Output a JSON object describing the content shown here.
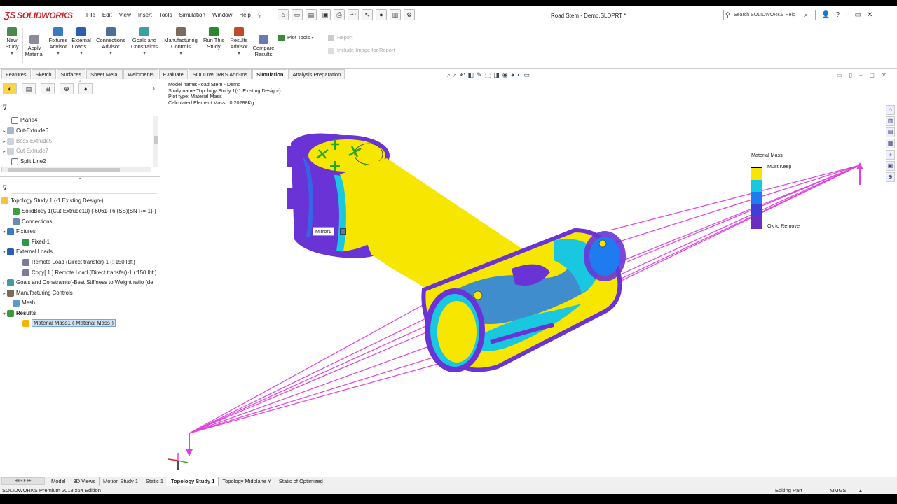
{
  "app": {
    "logo": "SOLIDWORKS",
    "document_title": "Road Stem - Demo.SLDPRT *"
  },
  "menu": [
    "File",
    "Edit",
    "View",
    "Insert",
    "Tools",
    "Simulation",
    "Window",
    "Help"
  ],
  "search": {
    "placeholder": "Search SOLIDWORKS Help"
  },
  "command_manager": {
    "buttons": [
      {
        "line1": "New",
        "line2": "Study"
      },
      {
        "line1": "Apply",
        "line2": "Material"
      },
      {
        "line1": "Fixtures",
        "line2": "Advisor"
      },
      {
        "line1": "External",
        "line2": "Loads..."
      },
      {
        "line1": "Connections",
        "line2": "Advisor"
      },
      {
        "line1": "Goals and",
        "line2": "Constraints"
      },
      {
        "line1": "Manufacturing",
        "line2": "Controls"
      },
      {
        "line1": "Run This",
        "line2": "Study"
      },
      {
        "line1": "Results",
        "line2": "Advisor"
      },
      {
        "line1": "Compare",
        "line2": "Results"
      }
    ],
    "plot_tools": "Plot Tools",
    "report": "Report",
    "include_image": "Include Image for Report"
  },
  "cmd_tabs": [
    "Features",
    "Sketch",
    "Surfaces",
    "Sheet Metal",
    "Weldments",
    "Evaluate",
    "SOLIDWORKS Add-Ins",
    "Simulation",
    "Analysis Preparation"
  ],
  "active_cmd_tab": "Simulation",
  "feature_tree": [
    {
      "label": "Plane4",
      "grey": false
    },
    {
      "label": "Cut-Extrude6",
      "grey": false
    },
    {
      "label": "Boss-Extrude5",
      "grey": true
    },
    {
      "label": "Cut-Extrude7",
      "grey": true
    },
    {
      "label": "Split Line2",
      "grey": false
    }
  ],
  "sim_tree": {
    "root": "Topology Study 1 (-1 Existing Design-)",
    "solidbody": "SolidBody 1(Cut-Extrude10) (-6061-T6 (SS)(SN R=-1)-)",
    "connections": "Connections",
    "fixtures": "Fixtures",
    "fixed": "Fixed-1",
    "external_loads": "External Loads",
    "remote_load": "Remote Load (Direct transfer)-1 (:-150 lbf:)",
    "copy_load": "Copy[ 1 ] Remote Load (Direct transfer)-1 (:150 lbf:)",
    "goals": "Goals and Constraints(-Best Stiffness to Weight ratio (de",
    "mfg_controls": "Manufacturing Controls",
    "mesh": "Mesh",
    "results": "Results",
    "material_mass": "Material Mass1 (-Material Mass-)"
  },
  "study_info": {
    "model_name": "Model name:Road Stem - Demo",
    "study_name": "Study name:Topology Study 1(-1 Existing Design-)",
    "plot_type": "Plot type: Material Mass",
    "element_mass": "Calculated Element Mass :  0.20288Kg"
  },
  "legend": {
    "title": "Material Mass",
    "max_label": "Must Keep",
    "min_label": "Ok to Remove",
    "colors": [
      "#f7e600",
      "#19c8e0",
      "#1e7cf0",
      "#3f3fd8",
      "#6a2ec0"
    ]
  },
  "mirror_tooltip": "Mirror1",
  "bottom_tabs": [
    "Model",
    "3D Views",
    "Motion Study 1",
    "Static 1",
    "Topology Study 1",
    "Topology Midplane Y",
    "Static of Optimized"
  ],
  "active_bottom_tab": "Topology Study 1",
  "status": {
    "edition": "SOLIDWORKS Premium 2018 x64 Edition",
    "editing": "Editing Part",
    "units": "MMGS"
  },
  "colors": {
    "yellow": "#f7e600",
    "cyan": "#19c8e0",
    "blue": "#1e7cf0",
    "purple": "#7a33d0",
    "load_magenta": "#e040e0",
    "fixture_green": "#22a822"
  }
}
